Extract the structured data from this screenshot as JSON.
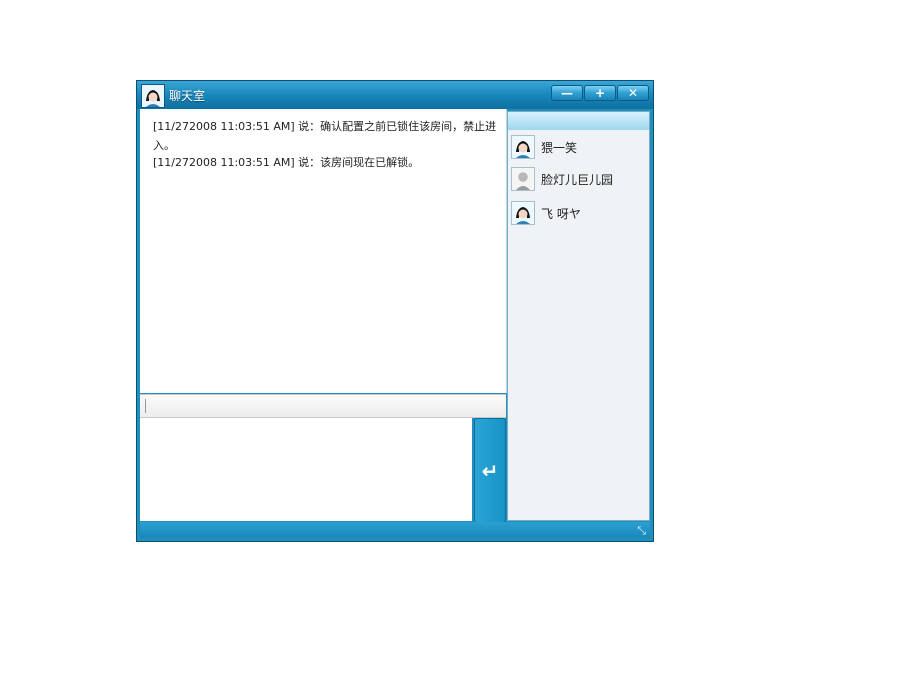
{
  "window": {
    "title": "聊天室",
    "buttons": {
      "minimize": "—",
      "maximize": "+",
      "close": "✕"
    }
  },
  "chat": {
    "lines": [
      "[11/272008 11:03:51 AM] 说：确认配置之前已锁住该房间，禁止进入。",
      "[11/272008 11:03:51 AM] 说：该房间现在已解锁。"
    ]
  },
  "send": {
    "label": "↵"
  },
  "users": [
    {
      "name": "猥一笑",
      "avatar_icon": "female-avatar-icon"
    },
    {
      "name": "脸灯儿巨儿园",
      "avatar_icon": "gray-avatar-icon"
    },
    {
      "name": "飞  呀ヤ",
      "avatar_icon": "female-avatar-icon"
    }
  ],
  "statusbar": {
    "resize_icon": "⤡"
  },
  "colors": {
    "window_blue": "#1f8fbd",
    "titlebar_light": "#3aa6d6",
    "titlebar_dark": "#0f6fa1"
  }
}
